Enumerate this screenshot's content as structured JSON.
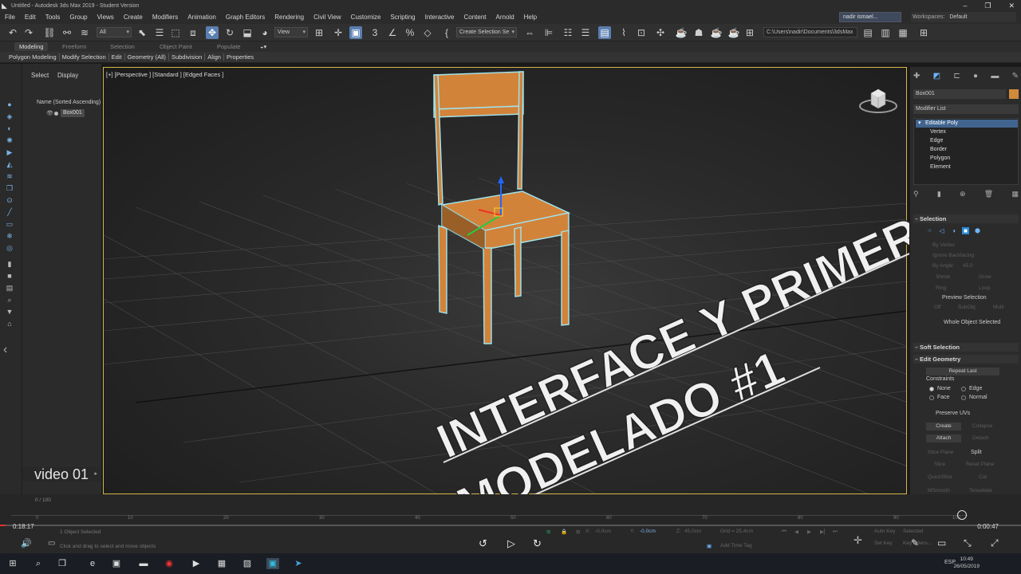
{
  "window": {
    "title": "Untitled - Autodesk 3ds Max 2019 - Student Version",
    "minimize": "–",
    "restore": "❐",
    "close": "✕"
  },
  "menu": {
    "items": [
      "File",
      "Edit",
      "Tools",
      "Group",
      "Views",
      "Create",
      "Modifiers",
      "Animation",
      "Graph Editors",
      "Rendering",
      "Civil View",
      "Customize",
      "Scripting",
      "Interactive",
      "Content",
      "Arnold",
      "Help"
    ],
    "user": "nadir ismael...",
    "workspace_label": "Workspaces:",
    "workspace_value": "Default"
  },
  "toolbar": {
    "filter_value": "All",
    "refcoord_value": "View",
    "selection_set_placeholder": "Create Selection Se",
    "project_path": "C:\\Users\\nadir\\Documents\\3dsMax"
  },
  "ribbon": {
    "tabs": [
      "Modeling",
      "Freeform",
      "Selection",
      "Object Paint",
      "Populate"
    ],
    "active_tab": "Modeling",
    "subitems": [
      "Polygon Modeling",
      "Modify Selection",
      "Edit",
      "Geometry (All)",
      "Subdivision",
      "Align",
      "Properties"
    ]
  },
  "scene_explorer": {
    "tab_select": "Select",
    "tab_display": "Display",
    "column_header": "Name (Sorted Ascending)",
    "objects": [
      "Box001"
    ]
  },
  "video_label": "video 01",
  "viewport": {
    "label": "[+] [Perspective ] [Standard ] [Edged Faces ]"
  },
  "overlay": {
    "line1": "INTERFACE Y PRIMER",
    "line2": "MODELADO #1"
  },
  "command_panel": {
    "object_name": "Box001",
    "object_color": "#d18a3a",
    "modifier_list": "Modifier List",
    "stack": [
      "Editable Poly",
      "Vertex",
      "Edge",
      "Border",
      "Polygon",
      "Element"
    ],
    "selection_title": "Selection",
    "by_vertex": "By Vertex",
    "ignore_backfacing": "Ignore Backfacing",
    "by_angle": "By Angle:",
    "by_angle_value": "45,0",
    "shrink": "Shrink",
    "grow": "Grow",
    "ring": "Ring",
    "loop": "Loop",
    "preview_selection": "Preview Selection",
    "off": "Off",
    "subobj": "SubObj",
    "multi": "Multi",
    "whole_object_selected": "Whole Object Selected",
    "soft_selection": "Soft Selection",
    "edit_geometry": "Edit Geometry",
    "repeat_last": "Repeat Last",
    "constraints": "Constraints",
    "c_none": "None",
    "c_edge": "Edge",
    "c_face": "Face",
    "c_normal": "Normal",
    "preserve_uvs": "Preserve UVs",
    "create": "Create",
    "collapse": "Collapse",
    "attach": "Attach",
    "detach": "Detach",
    "slice_plane": "Slice Plane",
    "split": "Split",
    "slice": "Slice",
    "reset_plane": "Reset Plane",
    "quickslice": "QuickSlice",
    "cut": "Cut",
    "msmooth": "MSmooth",
    "tessellate": "Tessellate"
  },
  "timeline": {
    "frame_counter": "0 / 100",
    "ticks": [
      "0",
      "10",
      "20",
      "30",
      "40",
      "50",
      "60",
      "70",
      "80",
      "90",
      "100"
    ]
  },
  "status": {
    "time_current": "0:18:17",
    "time_total": "0:00:47",
    "objects_selected": "1 Object Selected",
    "hint": "Click and drag to select and move objects",
    "x_label": "X:",
    "x_value": "-0,0cm",
    "y_label": "Y:",
    "y_value": "-0,0cm",
    "z_label": "Z:",
    "z_value": "45,0cm",
    "grid": "Grid = 25,4cm",
    "add_time_tag": "Add Time Tag",
    "auto_key": "Auto Key",
    "selected": "Selected",
    "set_key": "Set Key",
    "key_filters": "Key Filters..."
  },
  "taskbar": {
    "lang": "ESP",
    "time": "10:49",
    "date": "26/05/2019"
  }
}
